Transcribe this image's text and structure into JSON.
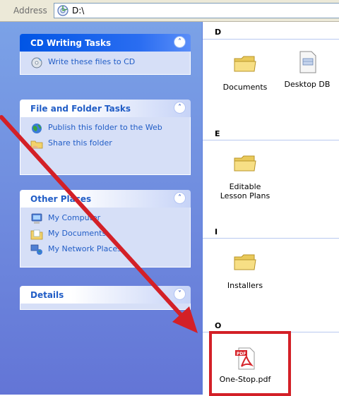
{
  "address_bar": {
    "label": "Address",
    "path": "D:\\"
  },
  "task_pane": {
    "groups": [
      {
        "title": "CD Writing Tasks",
        "tasks": [
          {
            "label": "Write these files to CD",
            "icon": "cd-write-icon"
          }
        ]
      },
      {
        "title": "File and Folder Tasks",
        "tasks": [
          {
            "label": "Publish this folder to the Web",
            "icon": "globe-publish-icon"
          },
          {
            "label": "Share this folder",
            "icon": "share-folder-icon"
          }
        ]
      },
      {
        "title": "Other Places",
        "tasks": [
          {
            "label": "My Computer",
            "icon": "my-computer-icon"
          },
          {
            "label": "My Documents",
            "icon": "my-documents-icon"
          },
          {
            "label": "My Network Places",
            "icon": "network-places-icon"
          }
        ]
      },
      {
        "title": "Details",
        "tasks": []
      }
    ]
  },
  "files": {
    "sections": [
      {
        "letter": "D",
        "items": [
          {
            "name": "Documents",
            "icon": "folder-icon"
          },
          {
            "name": "Desktop DB",
            "icon": "database-file-icon"
          }
        ]
      },
      {
        "letter": "E",
        "items": [
          {
            "name": "Editable Lesson Plans",
            "icon": "folder-icon"
          }
        ]
      },
      {
        "letter": "I",
        "items": [
          {
            "name": "Installers",
            "icon": "folder-icon"
          }
        ]
      },
      {
        "letter": "O",
        "items": [
          {
            "name": "One-Stop.pdf",
            "icon": "pdf-file-icon"
          }
        ]
      }
    ]
  },
  "annotation": {
    "color": "#d32027"
  },
  "colors": {
    "taskpane_top": "#7ba2e7",
    "taskpane_bottom": "#6375d6",
    "link": "#215dc6"
  }
}
